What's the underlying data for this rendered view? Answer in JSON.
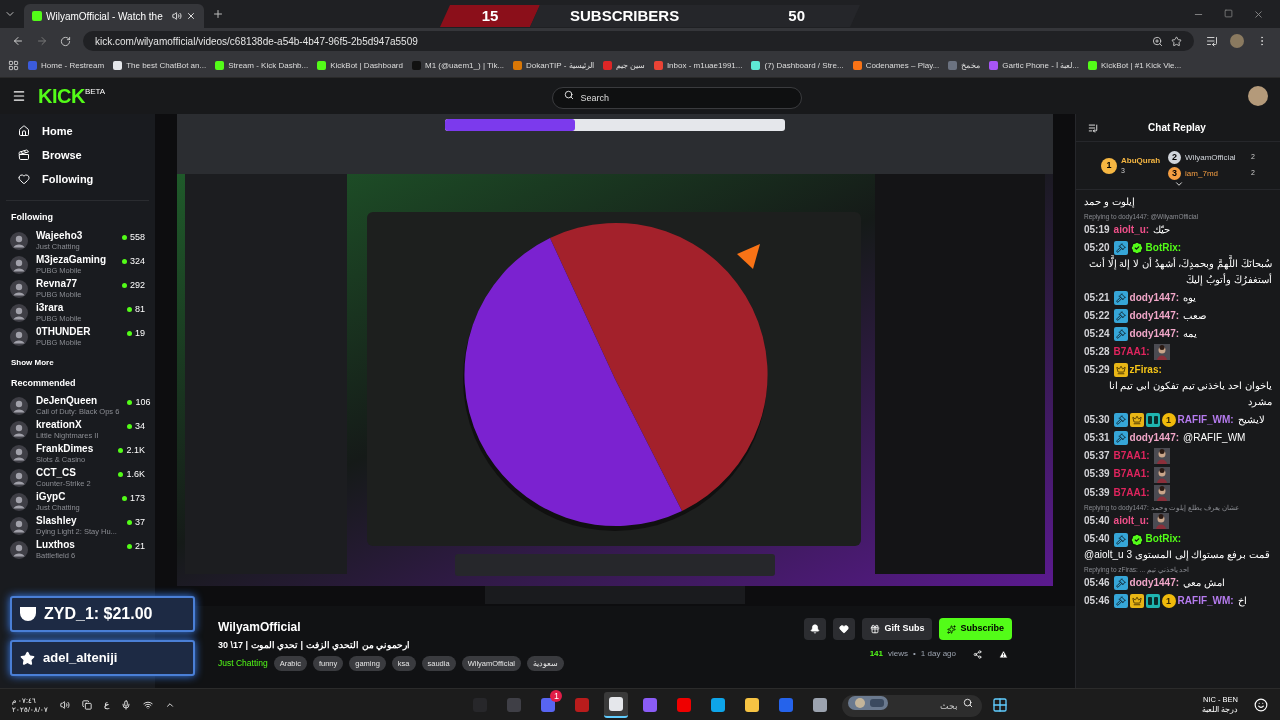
{
  "browser": {
    "tab_title": "WilyamOfficial - Watch the",
    "url": "kick.com/wilyamofficial/videos/c68138de-a54b-4b47-96f5-2b5d947a5509",
    "bookmarks": [
      {
        "label": "Home - Restream",
        "color": "#3b5bdb"
      },
      {
        "label": "The best ChatBot an...",
        "color": "#e5e7eb"
      },
      {
        "label": "Stream - Kick Dashb...",
        "color": "#53fc18"
      },
      {
        "label": "KickBot | Dashboard",
        "color": "#53fc18"
      },
      {
        "label": "M1 (@uaem1_) | Tik...",
        "color": "#111111"
      },
      {
        "label": "DokanTIP - الرئيسية",
        "color": "#d97706"
      },
      {
        "label": "سين جيم",
        "color": "#dc2626"
      },
      {
        "label": "Inbox - m1uae1991...",
        "color": "#ea4335"
      },
      {
        "label": "(7) Dashboard / Stre...",
        "color": "#5eead4"
      },
      {
        "label": "Codenames – Play...",
        "color": "#f97316"
      },
      {
        "label": "مخمخ",
        "color": "#6b7280"
      },
      {
        "label": "Gartic Phone - لعبة ا...",
        "color": "#a855f7"
      },
      {
        "label": "KickBot | #1 Kick Vie...",
        "color": "#53fc18"
      }
    ]
  },
  "subscriber_goal": {
    "current": "15",
    "label": "SUBSCRIBERS",
    "goal": "50"
  },
  "header": {
    "logo": "KICK",
    "logo_tag": "BETA",
    "search_placeholder": "Search"
  },
  "sidebar": {
    "nav": [
      {
        "label": "Home",
        "kind": "home",
        "selected": false
      },
      {
        "label": "Browse",
        "kind": "browse",
        "selected": false
      },
      {
        "label": "Following",
        "kind": "following",
        "selected": false
      }
    ],
    "following_title": "Following",
    "following": [
      {
        "name": "Wajeeho3",
        "category": "Just Chatting",
        "viewers": "558"
      },
      {
        "name": "M3jezaGaming",
        "category": "PUBG Mobile",
        "viewers": "324"
      },
      {
        "name": "Revna77",
        "category": "PUBG Mobile",
        "viewers": "292"
      },
      {
        "name": "i3rara",
        "category": "PUBG Mobile",
        "viewers": "81"
      },
      {
        "name": "0THUNDER",
        "category": "PUBG Mobile",
        "viewers": "19"
      }
    ],
    "show_more": "Show More",
    "recommended_title": "Recommended",
    "recommended": [
      {
        "name": "DeJenQueen",
        "category": "Call of Duty: Black Ops 6",
        "viewers": "106"
      },
      {
        "name": "kreationX",
        "category": "Little Nightmares II",
        "viewers": "34"
      },
      {
        "name": "FrankDimes",
        "category": "Slots & Casino",
        "viewers": "2.1K"
      },
      {
        "name": "CCT_CS",
        "category": "Counter-Strike 2",
        "viewers": "1.6K"
      },
      {
        "name": "iGypC",
        "category": "Just Chatting",
        "viewers": "173"
      },
      {
        "name": "Slashley",
        "category": "Dying Light 2: Stay Hu...",
        "viewers": "37"
      },
      {
        "name": "Luxthos",
        "category": "Battlefield 6",
        "viewers": "21"
      }
    ]
  },
  "alerts": [
    {
      "kind": "donation",
      "text": "ZYD_1: $21.00"
    },
    {
      "kind": "follow",
      "text": "adel_alteniji"
    }
  ],
  "info": {
    "channel": "WilyamOfficial",
    "title": "ارحموني من التحدي الزفت | تحدي الموت | 17\\ 30",
    "category": "Just Chatting",
    "tags": [
      "Arabic",
      "funny",
      "gaming",
      "ksa",
      "saudia",
      "WilyamOfficial",
      "سعودية"
    ],
    "gift_label": "Gift Subs",
    "subscribe_label": "Subscribe",
    "views": "141",
    "views_label": "views",
    "separator": "•",
    "age": "1 day ago"
  },
  "chat": {
    "title": "Chat Replay",
    "leaders": [
      {
        "rank": "1",
        "name": "AbuQurah",
        "count": "3",
        "color": "#f5b642"
      },
      {
        "rank": "2",
        "name": "WilyamOfficial",
        "count": "2",
        "color": "#d1d5db"
      },
      {
        "rank": "3",
        "name": "iam_7md",
        "count": "2",
        "color": "#f59e42"
      }
    ],
    "messages": [
      {
        "text": "إيلوت و حمد"
      },
      {
        "reply": "Replying to dody1447: @WilyamOfficial",
        "time": "05:19",
        "user": "aiolt_u:",
        "color": "#f0508a",
        "text": "حيّك"
      },
      {
        "time": "05:20",
        "badges": [
          {
            "kind": "mod"
          },
          {
            "kind": "verified"
          }
        ],
        "user": "BotRix:",
        "color": "#53fc18",
        "text": "سُبحانَكَ اللَّهمَّ وبحمدِكَ، أشهدُ أن لا إلهَ إلَّا أنتَ أستغفرُكَ وأتوبُ إليكَ"
      },
      {
        "time": "05:21",
        "badges": [
          {
            "kind": "mod"
          }
        ],
        "user": "dody1447:",
        "color": "#f2a7c9",
        "text": "يوه"
      },
      {
        "time": "05:22",
        "badges": [
          {
            "kind": "mod"
          }
        ],
        "user": "dody1447:",
        "color": "#f2a7c9",
        "text": "صعب"
      },
      {
        "time": "05:24",
        "badges": [
          {
            "kind": "mod"
          }
        ],
        "user": "dody1447:",
        "color": "#f2a7c9",
        "text": "يمه"
      },
      {
        "time": "05:28",
        "user": "B7AA1:",
        "color": "#e0245e",
        "emote": true
      },
      {
        "time": "05:29",
        "badges": [
          {
            "kind": "crown"
          }
        ],
        "user": "zFiras:",
        "color": "#f5c518",
        "text": "ياخوان احد ياخذني تيم تفكون ابي تيم انا مشرد"
      },
      {
        "time": "05:30",
        "badges": [
          {
            "kind": "mod"
          },
          {
            "kind": "crown"
          },
          {
            "kind": "og"
          },
          {
            "kind": "tier",
            "text": "1"
          }
        ],
        "user": "RAFIF_WM:",
        "color": "#b57bee",
        "text": "لايشيح"
      },
      {
        "time": "05:31",
        "badges": [
          {
            "kind": "mod"
          }
        ],
        "user": "dody1447:",
        "color": "#f2a7c9",
        "text": "@RAFIF_WM"
      },
      {
        "time": "05:37",
        "user": "B7AA1:",
        "color": "#e0245e",
        "emote": true
      },
      {
        "time": "05:39",
        "user": "B7AA1:",
        "color": "#e0245e",
        "emote": true
      },
      {
        "time": "05:39",
        "user": "B7AA1:",
        "color": "#e0245e",
        "emote": true
      },
      {
        "reply": "Replying to dody1447: عشان يعرف يطلع إيلوت و حمد",
        "time": "05:40",
        "user": "aiolt_u:",
        "color": "#f0508a",
        "emote": true
      },
      {
        "time": "05:40",
        "badges": [
          {
            "kind": "mod"
          },
          {
            "kind": "verified"
          }
        ],
        "user": "BotRix:",
        "color": "#53fc18",
        "text": "@aiolt_u قمت برفع مستواك إلى المستوى 3"
      },
      {
        "reply": "Replying to zFiras: ... احد ياخذني تيم",
        "time": "05:46",
        "badges": [
          {
            "kind": "mod"
          }
        ],
        "user": "dody1447:",
        "color": "#f2a7c9",
        "text": "امش معي"
      },
      {
        "time": "05:46",
        "badges": [
          {
            "kind": "mod"
          },
          {
            "kind": "crown"
          },
          {
            "kind": "og"
          },
          {
            "kind": "tier",
            "text": "1"
          }
        ],
        "user": "RAFIF_WM:",
        "color": "#b57bee",
        "text": "اخ"
      }
    ]
  },
  "taskbar": {
    "time": "٠٧:٤٦ م",
    "date": "٢٠٢٥/٠٨/٠٧",
    "language": "ع",
    "search_placeholder": "بحث",
    "network": "NIC - BEN",
    "status": "درجة اللعبة",
    "apps": [
      {
        "kind": "obs",
        "selected": false
      },
      {
        "kind": "app",
        "selected": false
      },
      {
        "kind": "discord",
        "badge": "1",
        "selected": false
      },
      {
        "kind": "voice",
        "selected": false
      },
      {
        "kind": "chrome",
        "selected": true
      },
      {
        "kind": "copilot",
        "selected": false
      },
      {
        "kind": "youtube",
        "selected": false
      },
      {
        "kind": "edge",
        "selected": false
      },
      {
        "kind": "folder",
        "selected": false
      },
      {
        "kind": "store",
        "selected": false
      },
      {
        "kind": "window",
        "selected": false
      }
    ]
  }
}
